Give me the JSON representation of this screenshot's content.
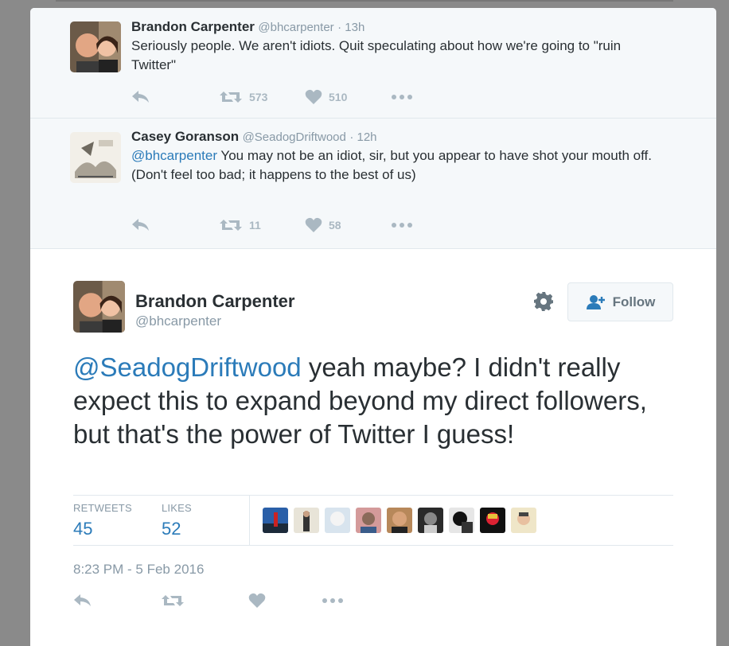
{
  "ancestors": [
    {
      "fullname": "Brandon Carpenter",
      "handle": "@bhcarpenter",
      "time": "· 13h",
      "text": "Seriously people.  We aren't idiots. Quit speculating about how we're going to \"ruin Twitter\"",
      "retweets": "573",
      "likes": "510"
    },
    {
      "fullname": "Casey Goranson",
      "handle": "@SeadogDriftwood",
      "time": "· 12h",
      "mention": "@bhcarpenter",
      "text": " You may not be an idiot, sir, but you appear to have shot your mouth off.",
      "text2": "(Don't feel too bad; it happens to the best of us)",
      "retweets": "11",
      "likes": "58"
    }
  ],
  "main": {
    "fullname": "Brandon Carpenter",
    "handle": "@bhcarpenter",
    "follow_label": "Follow",
    "mention": "@SeadogDriftwood",
    "text": " yeah maybe? I didn't really expect this to expand beyond my direct followers, but that's the power of Twitter I guess!",
    "retweets_label": "RETWEETS",
    "retweets": "45",
    "likes_label": "LIKES",
    "likes": "52",
    "timestamp": "8:23 PM - 5 Feb 2016"
  },
  "colors": {
    "link": "#2b7bb9",
    "muted": "#8899a6",
    "icon": "#aab8c2"
  }
}
